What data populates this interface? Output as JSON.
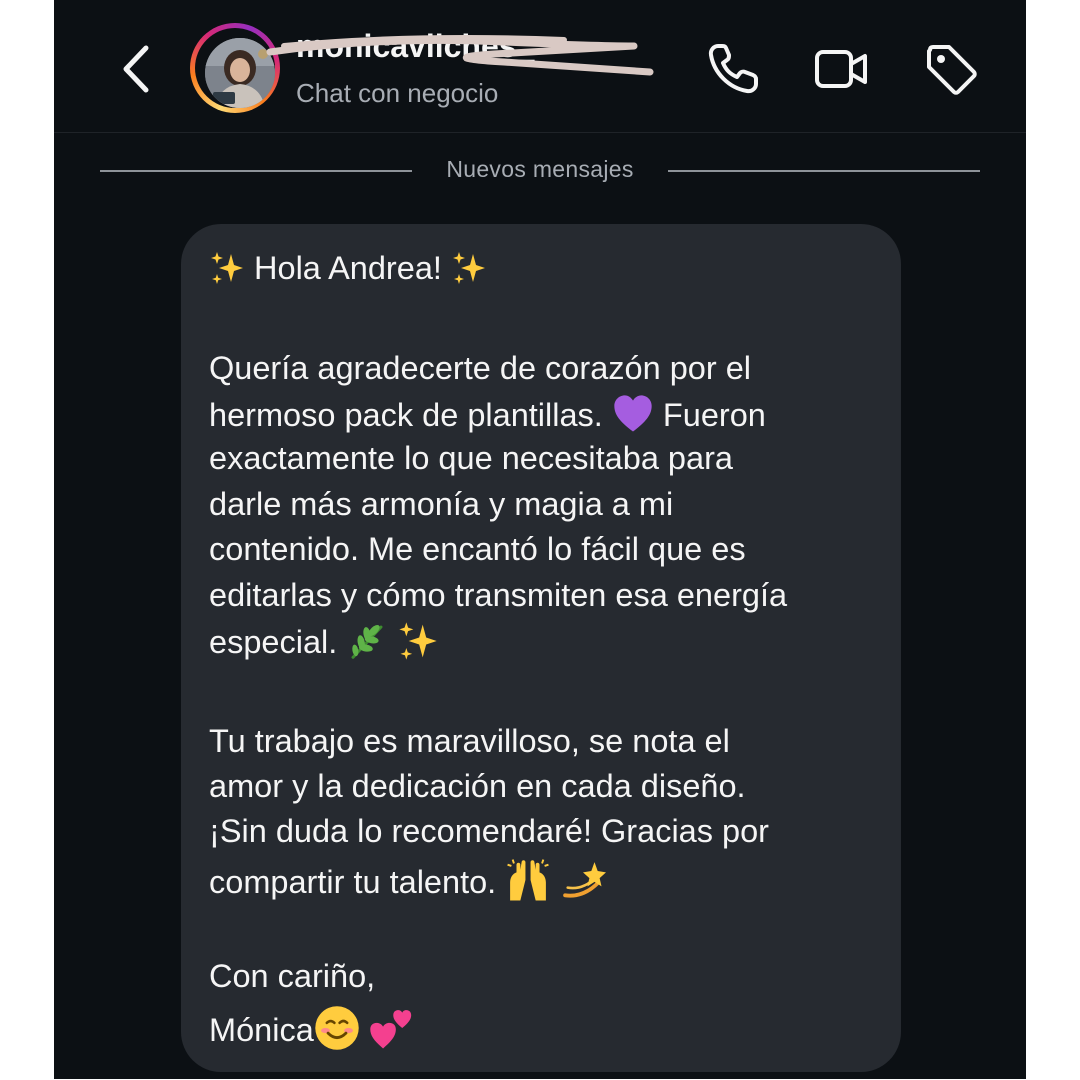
{
  "header": {
    "username": "monicavilches_",
    "subtitle": "Chat con negocio",
    "icons": {
      "back": "chevron-left-icon",
      "phone": "phone-icon",
      "video": "video-camera-icon",
      "tag": "tag-icon"
    }
  },
  "divider": {
    "label": "Nuevos mensajes"
  },
  "message": {
    "greeting": "Hola Andrea!",
    "p1_l1": "Quería agradecerte de corazón por el",
    "p1_l2a": "hermoso pack de plantillas.",
    "p1_l2b": "Fueron",
    "p1_l3": "exactamente lo que necesitaba para",
    "p1_l4": "darle más armonía y magia a mi",
    "p1_l5": "contenido. Me encantó lo fácil que es",
    "p1_l6": "editarlas y cómo transmiten esa energía",
    "p1_l7": "especial.",
    "p2_l1": "Tu trabajo es maravilloso, se nota el",
    "p2_l2": "amor y la dedicación en cada diseño.",
    "p2_l3": "¡Sin duda lo recomendaré! Gracias por",
    "p2_l4": "compartir tu talento.",
    "closing": "Con cariño,",
    "signature": "Mónica",
    "emojis": [
      "sparkles-icon",
      "purple-heart-icon",
      "herb-icon",
      "raising-hands-icon",
      "dizzy-star-icon",
      "smiling-face-icon",
      "two-hearts-icon"
    ]
  },
  "colors": {
    "background": "#0c1014",
    "bubble": "#262a30",
    "text": "#f5f5f5",
    "muted": "#a8adb4"
  }
}
